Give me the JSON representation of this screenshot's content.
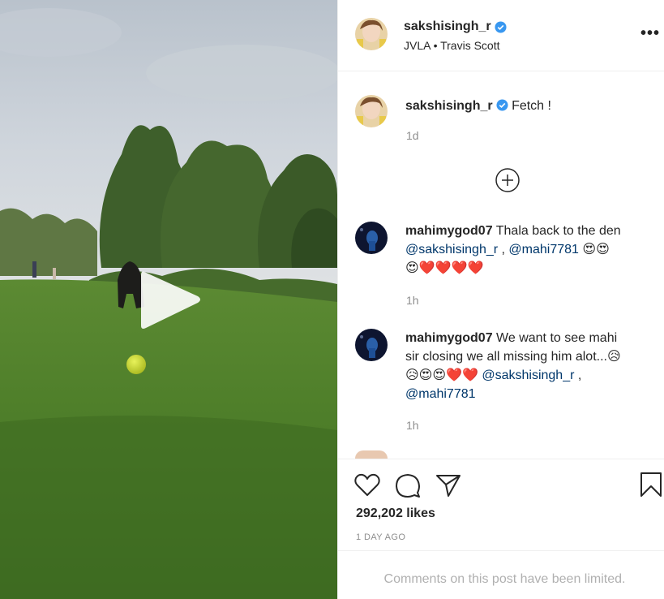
{
  "header": {
    "username": "sakshisingh_r",
    "audio": "JVLA • Travis Scott",
    "more": "•••"
  },
  "caption": {
    "username": "sakshisingh_r",
    "text": "Fetch !",
    "time": "1d"
  },
  "comments": [
    {
      "username": "mahimygod07",
      "line1": "Thala back to the den",
      "mention1": "@sakshisingh_r",
      "sep": " , ",
      "mention2": "@mahi7781",
      "emoji_line1": "😍😍",
      "emoji_line2": "😍❤️❤️❤️❤️",
      "time": "1h"
    },
    {
      "username": "mahimygod07",
      "line1": "We want to see mahi",
      "line2": "sir closing we all missing him alot...",
      "emoji_end": "😥",
      "emoji_line": "😥😍😍❤️❤️",
      "mention1": "@sakshisingh_r",
      "sep": " ,",
      "mention2": "@mahi7781",
      "time": "1h"
    }
  ],
  "actions": {
    "likes": "292,202 likes",
    "date": "1 DAY AGO"
  },
  "footer": {
    "limited": "Comments on this post have been limited."
  },
  "colors": {
    "verified": "#3897f0",
    "mention": "#00376b",
    "muted": "#8e8e8e"
  }
}
